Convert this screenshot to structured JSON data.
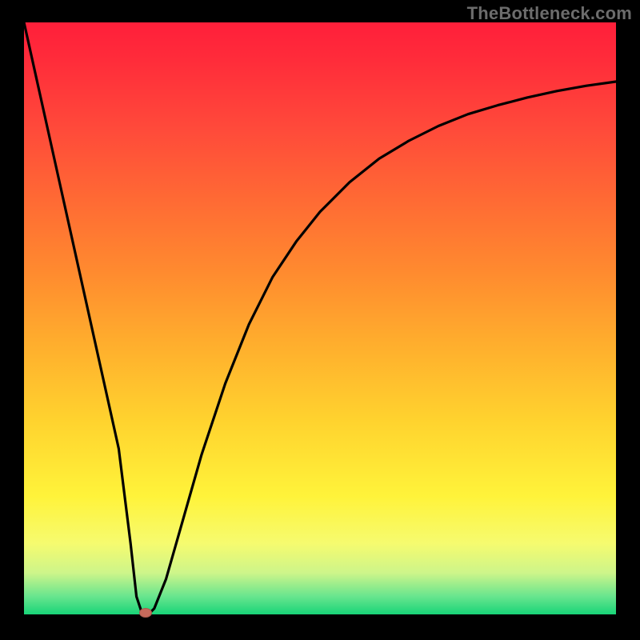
{
  "watermark": "TheBottleneck.com",
  "colors": {
    "frame": "#000000",
    "gradient_top": "#ff1f3a",
    "gradient_bottom": "#18d478",
    "curve": "#000000",
    "marker": "#c66a5b"
  },
  "chart_data": {
    "type": "line",
    "title": "",
    "xlabel": "",
    "ylabel": "",
    "xlim": [
      0,
      100
    ],
    "ylim": [
      0,
      100
    ],
    "grid": false,
    "legend": false,
    "series": [
      {
        "name": "bottleneck-curve",
        "x": [
          0,
          2,
          4,
          6,
          8,
          10,
          12,
          14,
          16,
          18,
          19,
          20,
          21,
          22,
          24,
          26,
          28,
          30,
          34,
          38,
          42,
          46,
          50,
          55,
          60,
          65,
          70,
          75,
          80,
          85,
          90,
          95,
          100
        ],
        "y": [
          100,
          91,
          82,
          73,
          64,
          55,
          46,
          37,
          28,
          12,
          3,
          0,
          0,
          1,
          6,
          13,
          20,
          27,
          39,
          49,
          57,
          63,
          68,
          73,
          77,
          80,
          82.5,
          84.5,
          86,
          87.3,
          88.4,
          89.3,
          90
        ]
      }
    ],
    "marker": {
      "x": 20.5,
      "y": 0
    }
  }
}
